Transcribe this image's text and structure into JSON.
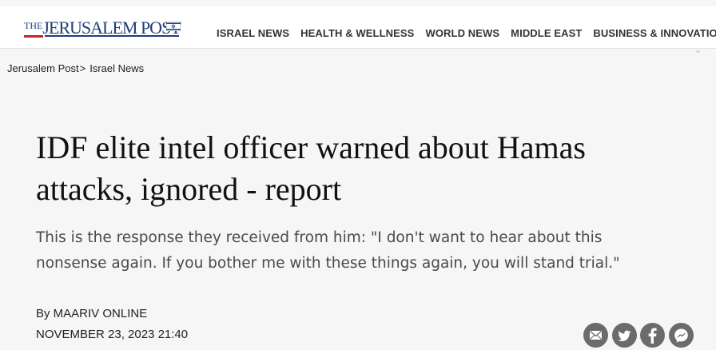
{
  "header": {
    "logo_text_the": "THE",
    "logo_text_main": "JERUSALEM POST",
    "nav": [
      "ISRAEL NEWS",
      "HEALTH & WELLNESS",
      "WORLD NEWS",
      "MIDDLE EAST",
      "BUSINESS & INNOVATION"
    ]
  },
  "breadcrumb": {
    "home": "Jerusalem Post",
    "separator": ">",
    "section": "Israel News"
  },
  "article": {
    "headline": "IDF elite intel officer warned about Hamas attacks, ignored - report",
    "subtitle": "This is the response they received from him: \"I don't want to hear about this nonsense again. If you bother me with these things again, you will stand trial.\"",
    "byline": "By MAARIV ONLINE",
    "date": "NOVEMBER 23, 2023 21:40"
  },
  "share_icons": [
    "email-icon",
    "twitter-icon",
    "facebook-icon",
    "messenger-icon"
  ],
  "colors": {
    "brand_blue": "#1f3e78",
    "brand_red": "#c1272d",
    "share_gray": "#6b6b6b",
    "page_bg": "#f6f6f6"
  }
}
